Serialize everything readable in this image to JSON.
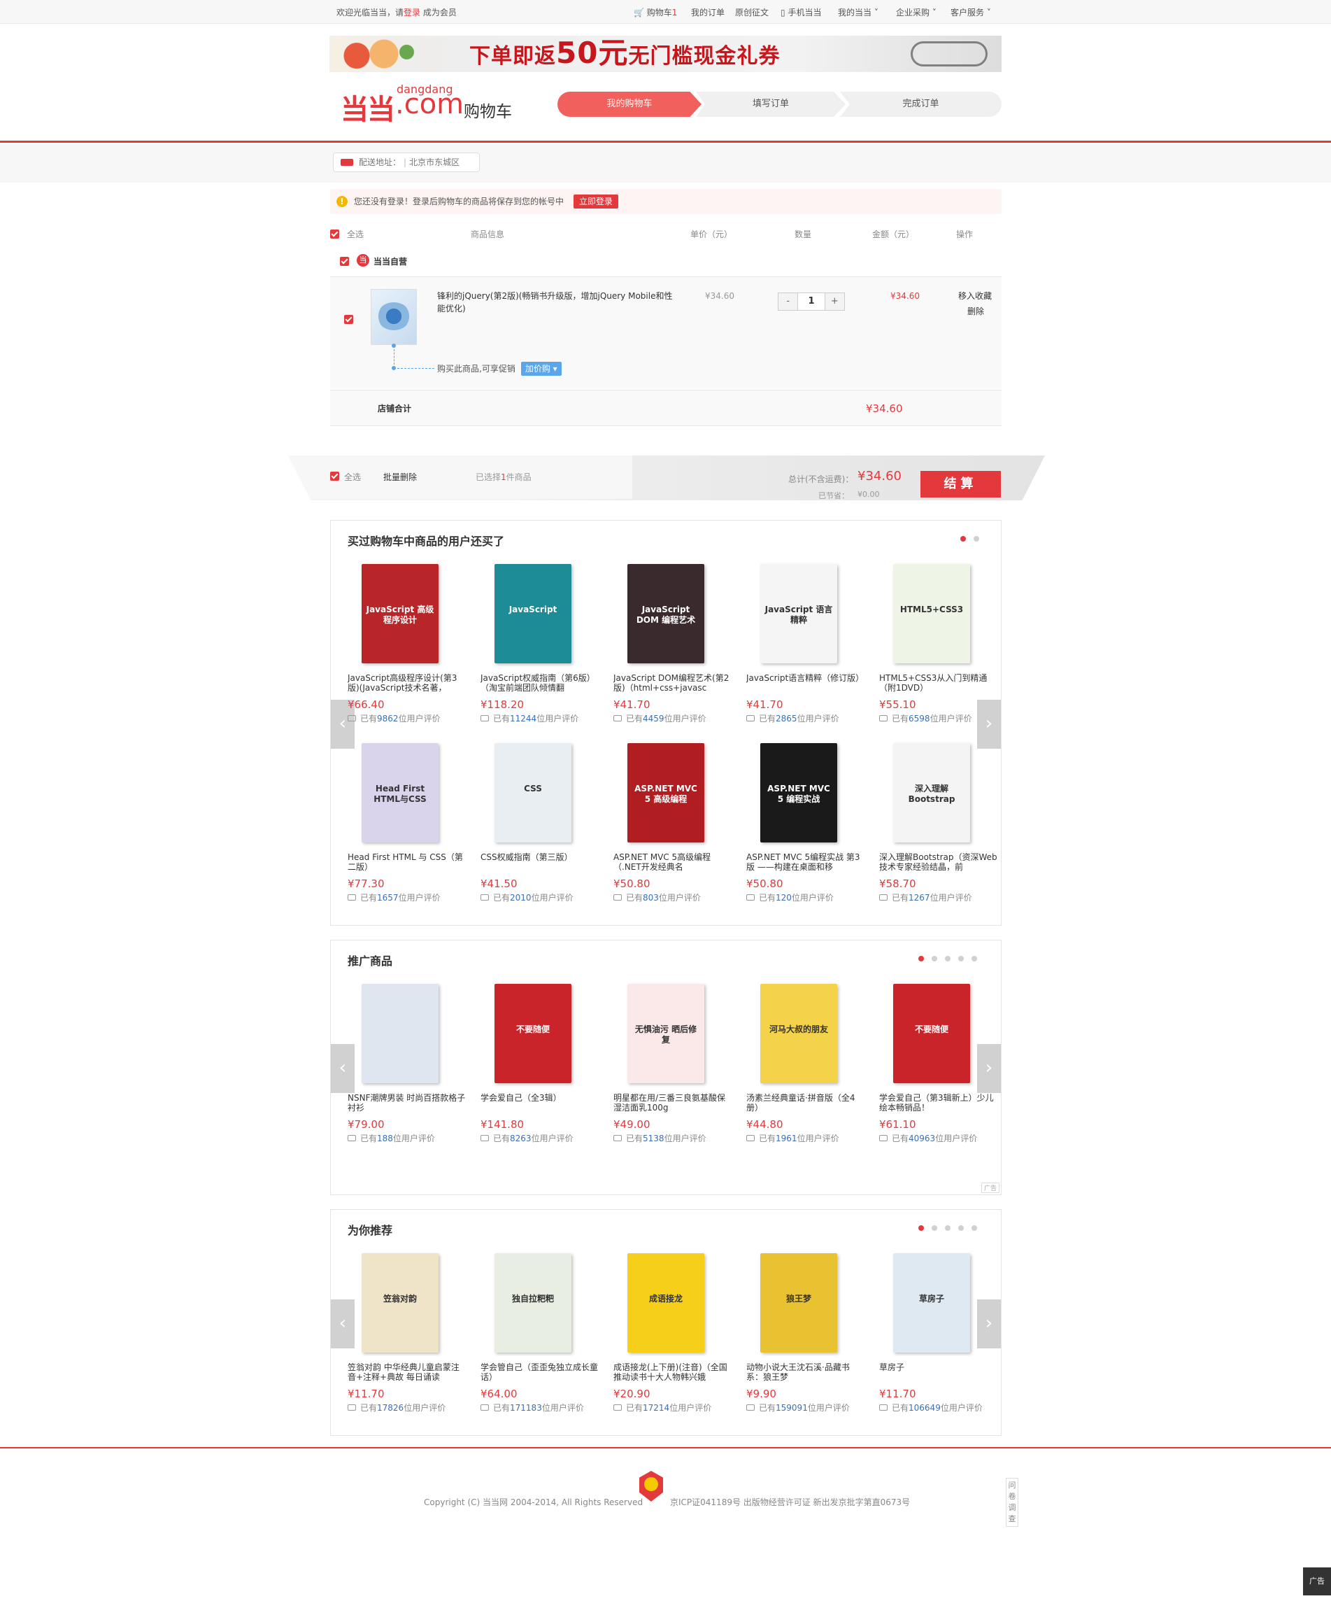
{
  "topbar": {
    "welcome": "欢迎光临当当，请",
    "login": "登录",
    "register": "成为会员",
    "cart": "购物车",
    "cart_count": "1",
    "links": [
      "我的订单",
      "原创征文",
      "手机当当",
      "我的当当",
      "企业采购",
      "客户服务"
    ]
  },
  "banner": {
    "text_pre": "下单即返",
    "text_num": "50元",
    "text_post": "无门槛现金礼券"
  },
  "logo": {
    "brand": "当当",
    "subtitle": "dangdang",
    "com": ".com",
    "page": "购物车"
  },
  "steps": [
    "我的购物车",
    "填写订单",
    "完成订单"
  ],
  "address": {
    "label": "配送地址：",
    "value": "北京市东城区"
  },
  "notice": {
    "text": "您还没有登录！登录后购物车的商品将保存到您的帐号中",
    "button": "立即登录"
  },
  "table_header": {
    "select_all": "全选",
    "info": "商品信息",
    "unit_price": "单价（元）",
    "qty": "数量",
    "amount": "金额（元）",
    "ops": "操作"
  },
  "shop": {
    "name": "当当自营",
    "icon": "当"
  },
  "cart_item": {
    "name": "锋利的jQuery(第2版)(畅销书升级版，增加jQuery Mobile和性能优化)",
    "unit_price": "¥34.60",
    "qty": "1",
    "minus": "-",
    "plus": "+",
    "amount": "¥34.60",
    "move_fav": "移入收藏",
    "delete": "删除",
    "promo_text": "购买此商品,可享促销",
    "promo_btn": "加价购 ▾"
  },
  "shop_total": {
    "label": "店铺合计",
    "value": "¥34.60"
  },
  "paybar": {
    "select_all": "全选",
    "batch_delete": "批量删除",
    "selected_pre": "已选择",
    "selected_n": "1",
    "selected_post": "件商品",
    "total_label": "总计(不含运费)：",
    "total": "¥34.60",
    "saved_label": "已节省：",
    "saved": "¥0.00",
    "checkout": "结算"
  },
  "sections": [
    {
      "title": "买过购物车中商品的用户还买了",
      "dots": 2,
      "items": [
        {
          "name": "JavaScript高级程序设计(第3版)(JavaScript技术名著，",
          "price": "¥66.40",
          "count": "9862",
          "cover": "#b8262a",
          "ctitle": "JavaScript 高级程序设计"
        },
        {
          "name": "JavaScript权威指南（第6版）（淘宝前端团队倾情翻",
          "price": "¥118.20",
          "count": "11244",
          "cover": "#1d8c96",
          "ctitle": "JavaScript"
        },
        {
          "name": "JavaScript DOM编程艺术(第2版)（html+css+javasc",
          "price": "¥41.70",
          "count": "4459",
          "cover": "#3a2a2e",
          "ctitle": "JavaScript DOM 编程艺术"
        },
        {
          "name": "JavaScript语言精粹（修订版）",
          "price": "¥41.70",
          "count": "2865",
          "cover": "#f5f5f5",
          "ctitle": "JavaScript 语言精粹"
        },
        {
          "name": "HTML5+CSS3从入门到精通（附1DVD）",
          "price": "¥55.10",
          "count": "6598",
          "cover": "#eef5e6",
          "ctitle": "HTML5+CSS3"
        },
        {
          "name": "Head First HTML 与 CSS（第二版）",
          "price": "¥77.30",
          "count": "1657",
          "cover": "#d9d4ec",
          "ctitle": "Head First HTML与CSS"
        },
        {
          "name": "CSS权威指南（第三版）",
          "price": "¥41.50",
          "count": "2010",
          "cover": "#e9eef2",
          "ctitle": "CSS"
        },
        {
          "name": "ASP.NET MVC 5高级编程（.NET开发经典名",
          "price": "¥50.80",
          "count": "803",
          "cover": "#b01e22",
          "ctitle": "ASP.NET MVC 5 高级编程"
        },
        {
          "name": "ASP.NET MVC 5编程实战 第3版 ——构建在桌面和移",
          "price": "¥50.80",
          "count": "120",
          "cover": "#1a1a1a",
          "ctitle": "ASP.NET MVC 5 编程实战"
        },
        {
          "name": "深入理解Bootstrap（资深Web技术专家经验结晶，前",
          "price": "¥58.70",
          "count": "1267",
          "cover": "#f4f4f4",
          "ctitle": "深入理解 Bootstrap"
        }
      ]
    },
    {
      "title": "推广商品",
      "dots": 5,
      "items": [
        {
          "name": "NSNF潮牌男装 时尚百搭款格子衬衫",
          "price": "¥79.00",
          "count": "188",
          "cover": "#dfe6ef",
          "ctitle": ""
        },
        {
          "name": "学会爱自己（全3辑）",
          "price": "¥141.80",
          "count": "8263",
          "cover": "#c8242a",
          "ctitle": "不要随便"
        },
        {
          "name": "明星都在用/三番三良氨基酸保湿洁面乳100g",
          "price": "¥49.00",
          "count": "5138",
          "cover": "#fbe9e9",
          "ctitle": "无惧油污 晒后修复"
        },
        {
          "name": "汤素兰经典童话·拼音版（全4册）",
          "price": "¥44.80",
          "count": "1961",
          "cover": "#f4d24a",
          "ctitle": "河马大叔的朋友"
        },
        {
          "name": "学会爱自己（第3辑新上）少儿绘本畅销品！",
          "price": "¥61.10",
          "count": "40963",
          "cover": "#c8242a",
          "ctitle": "不要随便"
        }
      ]
    },
    {
      "title": "为你推荐",
      "dots": 5,
      "items": [
        {
          "name": "笠翁对韵 中华经典儿童启蒙注音+注释+典故 每日诵读",
          "price": "¥11.70",
          "count": "17826",
          "cover": "#efe4c8",
          "ctitle": "笠翁对韵"
        },
        {
          "name": "学会管自己（歪歪兔独立成长童话）",
          "price": "¥64.00",
          "count": "171183",
          "cover": "#e8efe2",
          "ctitle": "独自拉粑粑"
        },
        {
          "name": "成语接龙(上下册)(注音)（全国推动读书十大人物韩兴娥",
          "price": "¥20.90",
          "count": "17214",
          "cover": "#f5cf1a",
          "ctitle": "成语接龙"
        },
        {
          "name": "动物小说大王沈石溪·品藏书系：狼王梦",
          "price": "¥9.90",
          "count": "159091",
          "cover": "#e8c230",
          "ctitle": "狼王梦"
        },
        {
          "name": "草房子",
          "price": "¥11.70",
          "count": "106649",
          "cover": "#dfe9f2",
          "ctitle": "草房子"
        }
      ]
    }
  ],
  "review_pre": "已有",
  "review_post": "位用户评价",
  "ad_label": "广告",
  "footer": {
    "copyright": "Copyright (C) 当当网 2004-2014, All Rights Reserved",
    "icp": "京ICP证041189号 出版物经营许可证 新出发京批字第直0673号",
    "survey": "问卷调查",
    "ad": "广告"
  }
}
